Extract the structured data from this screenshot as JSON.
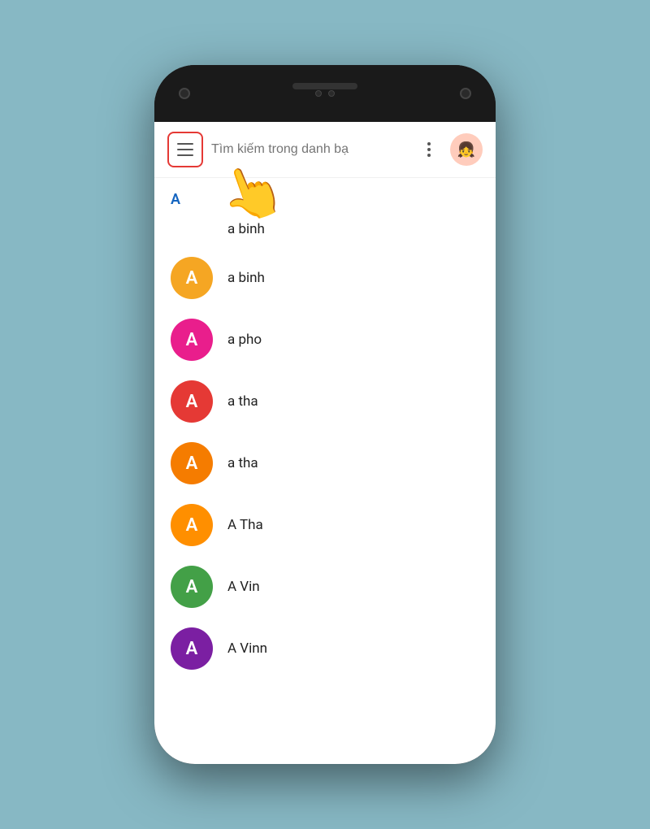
{
  "phone": {
    "background_color": "#87b8c4"
  },
  "app": {
    "search_placeholder": "Tìm kiếm trong danh bạ",
    "section_a_label": "A"
  },
  "contacts": [
    {
      "id": 1,
      "name": "a binh",
      "avatar_letter": null,
      "avatar_color": null,
      "plain": true
    },
    {
      "id": 2,
      "name": "a binh",
      "avatar_letter": "A",
      "avatar_color": "#f5a623"
    },
    {
      "id": 3,
      "name": "a pho",
      "avatar_letter": "A",
      "avatar_color": "#e91e8c"
    },
    {
      "id": 4,
      "name": "a tha",
      "avatar_letter": "A",
      "avatar_color": "#e53935"
    },
    {
      "id": 5,
      "name": "a tha",
      "avatar_letter": "A",
      "avatar_color": "#f57c00"
    },
    {
      "id": 6,
      "name": "A Tha",
      "avatar_letter": "A",
      "avatar_color": "#ff8f00"
    },
    {
      "id": 7,
      "name": "A Vin",
      "avatar_letter": "A",
      "avatar_color": "#43a047"
    },
    {
      "id": 8,
      "name": "A Vinn",
      "avatar_letter": "A",
      "avatar_color": "#7b1fa2"
    }
  ],
  "icons": {
    "menu": "☰",
    "more_vert": "⋮",
    "avatar_emoji": "👧"
  }
}
